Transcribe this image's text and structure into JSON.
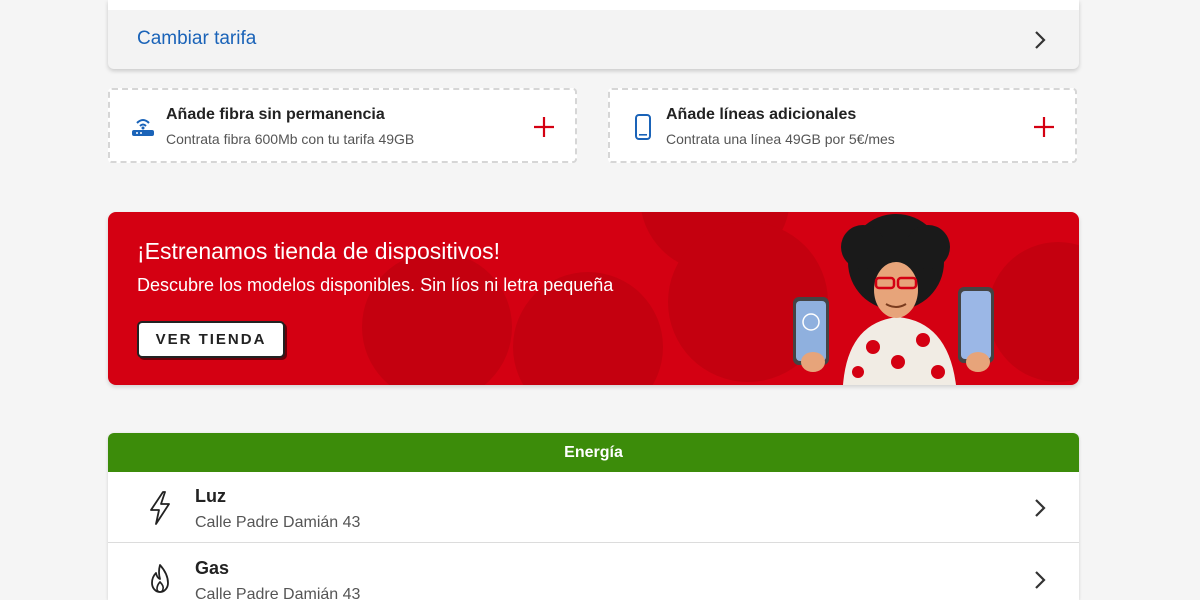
{
  "top_card": {
    "link_label": "Cambiar tarifa"
  },
  "add_cards": [
    {
      "title": "Añade fibra sin permanencia",
      "subtitle": "Contrata fibra 600Mb con tu tarifa 49GB",
      "icon": "router-icon"
    },
    {
      "title": "Añade líneas adicionales",
      "subtitle": "Contrata una línea 49GB por 5€/mes",
      "icon": "phone-icon"
    }
  ],
  "banner": {
    "title": "¡Estrenamos tienda de dispositivos!",
    "subtitle": "Descubre los modelos disponibles. Sin líos ni letra pequeña",
    "button_label": "VER TIENDA"
  },
  "energy": {
    "header": "Energía",
    "rows": [
      {
        "name": "Luz",
        "address": "Calle Padre Damián 43",
        "icon": "lightning-icon"
      },
      {
        "name": "Gas",
        "address": "Calle Padre Damián 43",
        "icon": "flame-icon"
      }
    ]
  },
  "colors": {
    "link": "#1a63b8",
    "brand_red": "#d40012",
    "energy_green": "#3c8c0a",
    "plus_red": "#d40012"
  }
}
